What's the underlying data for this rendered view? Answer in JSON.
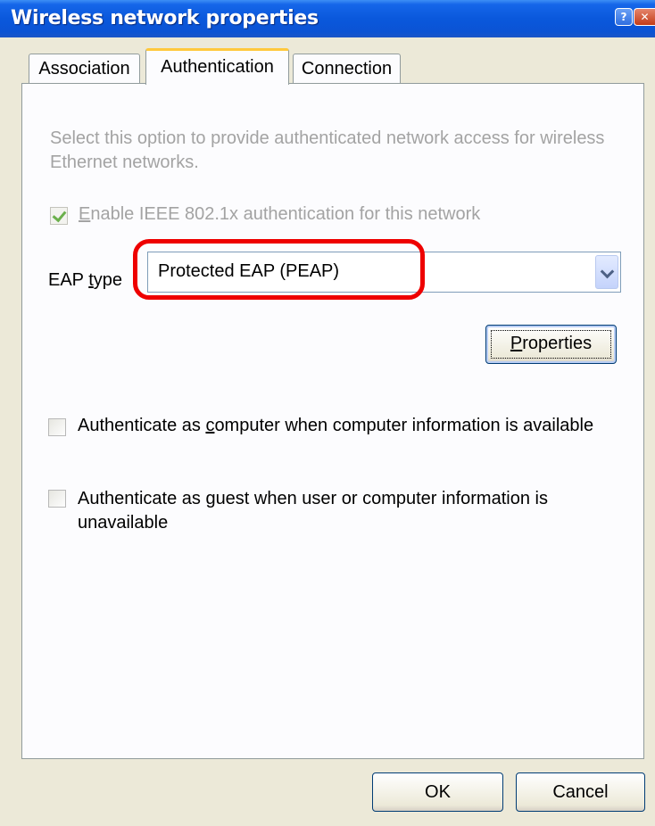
{
  "window": {
    "title": "Wireless network properties",
    "help_glyph": "?",
    "close_glyph": "✕"
  },
  "tabs": [
    {
      "label": "Association",
      "selected": false
    },
    {
      "label": "Authentication",
      "selected": true
    },
    {
      "label": "Connection",
      "selected": false
    }
  ],
  "auth": {
    "description": "Select this option to provide authenticated network access for wireless Ethernet networks.",
    "enable_8021x": {
      "pre": "",
      "mnemonic": "E",
      "post": "nable IEEE 802.1x authentication for this network",
      "checked": true,
      "disabled": true
    },
    "eap_type": {
      "label_pre": "EAP ",
      "label_mnemonic": "t",
      "label_post": "ype",
      "selected": "Protected EAP (PEAP)"
    },
    "properties_button": {
      "mnemonic": "P",
      "post": "roperties"
    },
    "auth_as_computer": {
      "pre": "Authenticate as ",
      "mnemonic": "c",
      "post": "omputer when computer information is available",
      "checked": false
    },
    "auth_as_guest": {
      "pre": "Authenticate as ",
      "mnemonic": "g",
      "post": "uest when user or computer information is unavailable",
      "checked": false
    }
  },
  "footer": {
    "ok_label": "OK",
    "cancel_label": "Cancel"
  },
  "colors": {
    "titlebar": "#0b53d4",
    "highlight": "#ee0000",
    "disabled_text": "#a3a3a3",
    "selected_tab_accent": "#ffc83c"
  }
}
